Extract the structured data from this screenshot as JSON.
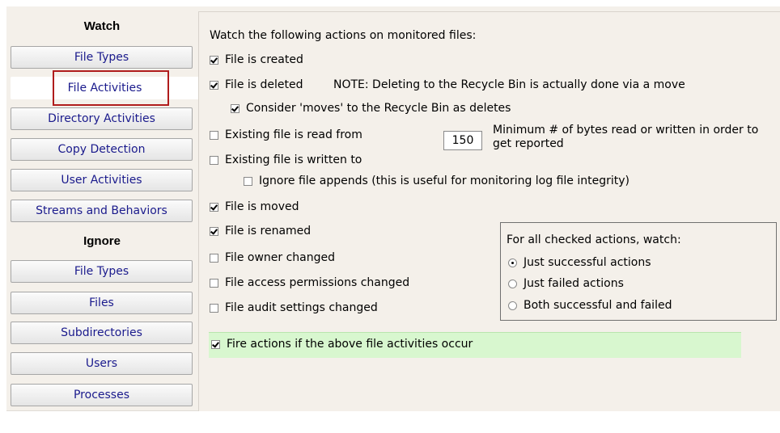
{
  "sidebar": {
    "watch_header": "Watch",
    "watch_items": [
      {
        "label": "File Types"
      },
      {
        "label": "File Activities",
        "selected": true
      },
      {
        "label": "Directory Activities"
      },
      {
        "label": "Copy Detection"
      },
      {
        "label": "User Activities"
      },
      {
        "label": "Streams and Behaviors"
      }
    ],
    "ignore_header": "Ignore",
    "ignore_items": [
      {
        "label": "File Types"
      },
      {
        "label": "Files"
      },
      {
        "label": "Subdirectories"
      },
      {
        "label": "Users"
      },
      {
        "label": "Processes"
      }
    ]
  },
  "main": {
    "intro": "Watch the following actions on monitored files:",
    "file_created": {
      "label": "File is created",
      "checked": true
    },
    "file_deleted": {
      "label": "File is deleted",
      "checked": true
    },
    "delete_note": "NOTE: Deleting to the Recycle Bin is actually done via a move",
    "consider_moves": {
      "label": "Consider 'moves' to the Recycle Bin as deletes",
      "checked": true
    },
    "read_from": {
      "label": "Existing file is read from",
      "checked": false
    },
    "min_bytes_value": "150",
    "min_bytes_note": "Minimum # of bytes read or written in order to get reported",
    "written_to": {
      "label": "Existing file is written to",
      "checked": false
    },
    "ignore_appends": {
      "label": "Ignore file appends (this is useful for monitoring log file integrity)",
      "checked": false
    },
    "moved": {
      "label": "File is moved",
      "checked": true
    },
    "renamed": {
      "label": "File is renamed",
      "checked": true
    },
    "owner_changed": {
      "label": "File owner changed",
      "checked": false
    },
    "permissions_changed": {
      "label": "File access permissions changed",
      "checked": false
    },
    "audit_changed": {
      "label": "File audit settings changed",
      "checked": false
    },
    "watch_group": {
      "title": "For all checked actions, watch:",
      "options": [
        {
          "label": "Just successful actions",
          "selected": true
        },
        {
          "label": "Just failed actions",
          "selected": false
        },
        {
          "label": "Both successful and failed",
          "selected": false
        }
      ]
    },
    "fire_actions": {
      "label": "Fire actions if the above file activities occur",
      "checked": true
    }
  },
  "colors": {
    "highlight_border": "#b01c1c",
    "fire_bar_bg": "#d8f7cf",
    "panel_bg": "#f4f0ea",
    "link_text": "#1a1a8c"
  }
}
